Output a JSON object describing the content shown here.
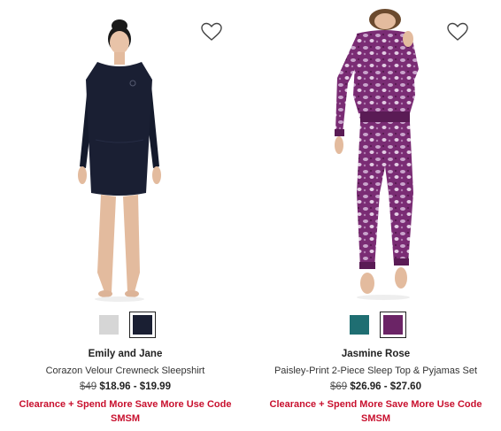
{
  "products": [
    {
      "brand": "Emily and Jane",
      "name": "Corazon Velour Crewneck Sleepshirt",
      "original_price": "$49",
      "sale_price": "$18.96 - $19.99",
      "promo": "Clearance + Spend More Save More Use Code SMSM",
      "swatch_colors": [
        "#d6d6d6",
        "#1a1f33"
      ],
      "selected_swatch": 1,
      "wishlist_icon": "heart-outline-icon"
    },
    {
      "brand": "Jasmine Rose",
      "name": "Paisley-Print 2-Piece Sleep Top & Pyjamas Set",
      "original_price": "$69",
      "sale_price": "$26.96 - $27.60",
      "promo": "Clearance + Spend More Save More Use Code SMSM",
      "swatch_colors": [
        "#1f6e72",
        "#6b2466"
      ],
      "selected_swatch": 1,
      "wishlist_icon": "heart-outline-icon"
    }
  ],
  "colors": {
    "promo": "#c8102e",
    "text": "#222222"
  }
}
